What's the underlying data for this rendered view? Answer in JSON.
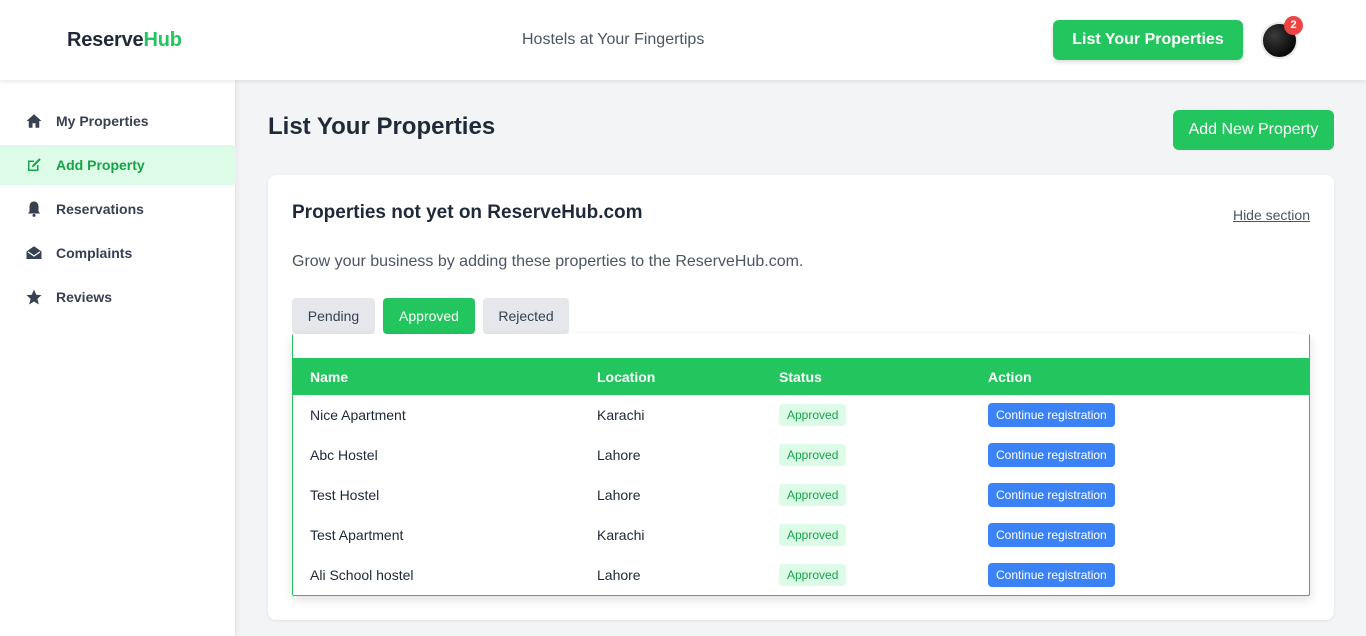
{
  "header": {
    "logo_main": "Reserve",
    "logo_accent": "Hub",
    "tagline": "Hostels at Your Fingertips",
    "list_button": "List Your Properties",
    "notification_count": "2"
  },
  "sidebar": {
    "items": [
      {
        "label": "My Properties",
        "icon": "home-icon",
        "active": false
      },
      {
        "label": "Add Property",
        "icon": "edit-icon",
        "active": true
      },
      {
        "label": "Reservations",
        "icon": "bell-icon",
        "active": false
      },
      {
        "label": "Complaints",
        "icon": "envelope-open-icon",
        "active": false
      },
      {
        "label": "Reviews",
        "icon": "star-icon",
        "active": false
      }
    ]
  },
  "main": {
    "title": "List Your Properties",
    "add_button": "Add New Property",
    "card": {
      "title": "Properties not yet on ReserveHub.com",
      "hide_link": "Hide section",
      "description": "Grow your business by adding these properties to the ReserveHub.com.",
      "tabs": [
        {
          "label": "Pending",
          "active": false
        },
        {
          "label": "Approved",
          "active": true
        },
        {
          "label": "Rejected",
          "active": false
        }
      ],
      "table": {
        "headers": [
          "Name",
          "Location",
          "Status",
          "Action"
        ],
        "rows": [
          {
            "name": "Nice Apartment",
            "location": "Karachi",
            "status": "Approved",
            "action": "Continue registration"
          },
          {
            "name": "Abc Hostel",
            "location": "Lahore",
            "status": "Approved",
            "action": "Continue registration"
          },
          {
            "name": "Test Hostel",
            "location": "Lahore",
            "status": "Approved",
            "action": "Continue registration"
          },
          {
            "name": "Test Apartment",
            "location": "Karachi",
            "status": "Approved",
            "action": "Continue registration"
          },
          {
            "name": "Ali School hostel",
            "location": "Lahore",
            "status": "Approved",
            "action": "Continue registration"
          }
        ]
      }
    }
  },
  "colors": {
    "brand_green": "#22c55e",
    "active_bg": "#dcfce7",
    "action_blue": "#3b82f6",
    "badge_red": "#ef4444"
  }
}
